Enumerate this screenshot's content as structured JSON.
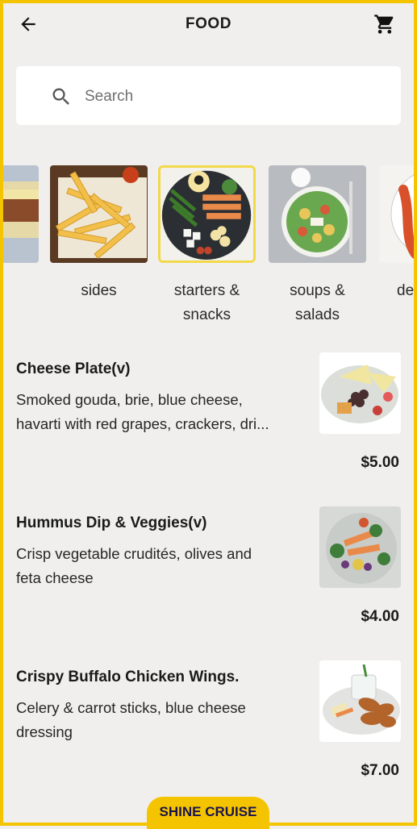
{
  "header": {
    "title": "FOOD",
    "back_icon": "arrow-left-icon",
    "cart_icon": "shopping-cart-icon"
  },
  "search": {
    "placeholder": "Search",
    "icon": "search-icon"
  },
  "categories": [
    {
      "label": ""
    },
    {
      "label": "sides"
    },
    {
      "label": "starters &\nsnacks",
      "line1": "starters &",
      "line2": "snacks",
      "selected": true
    },
    {
      "label": "soups &\nsalads",
      "line1": "soups &",
      "line2": "salads"
    },
    {
      "label": "de"
    }
  ],
  "menu_items": [
    {
      "name": "Cheese Plate(v)",
      "description": "Smoked gouda, brie, blue cheese, havarti with red grapes, crackers, dri...",
      "desc_line1": "Smoked gouda, brie, blue cheese,",
      "desc_line2": "havarti with red grapes, crackers, dri...",
      "price": "$5.00"
    },
    {
      "name": "Hummus Dip & Veggies(v)",
      "description": "Crisp vegetable crudités, olives and feta cheese",
      "desc_line1": "Crisp vegetable crudités, olives and",
      "desc_line2": "feta cheese",
      "price": "$4.00"
    },
    {
      "name": "Crispy Buffalo Chicken Wings.",
      "description": "Celery & carrot sticks, blue cheese dressing",
      "desc_line1": "Celery & carrot sticks, blue cheese",
      "desc_line2": "dressing",
      "price": "$7.00"
    }
  ],
  "brand": {
    "label": "SHINE CRUISE",
    "accent": "#f5c400"
  }
}
